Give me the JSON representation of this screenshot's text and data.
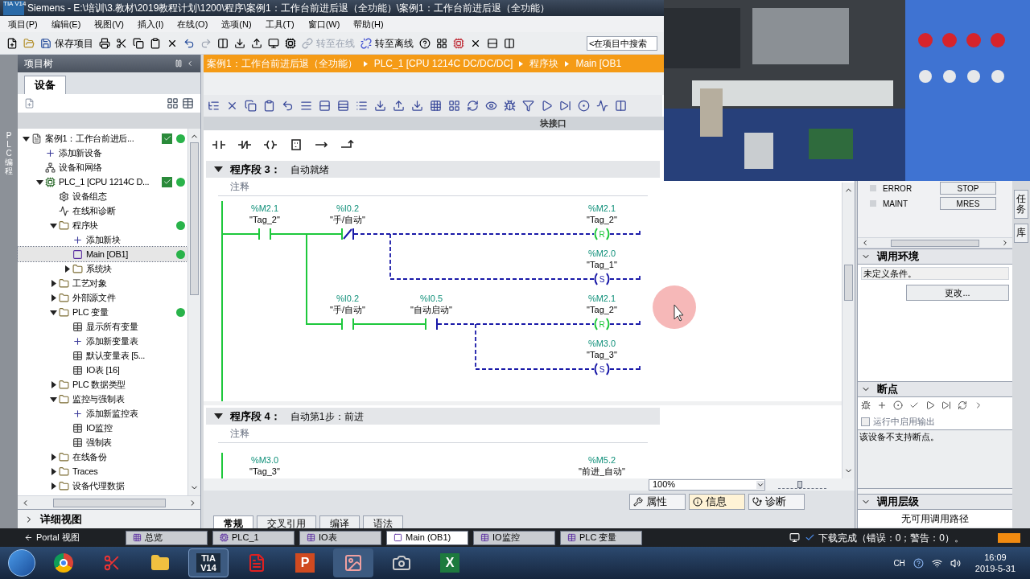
{
  "window": {
    "app_icon": "TIA V14",
    "title": "Siemens  -  E:\\培训\\3.教材\\2019教程计划\\1200\\程序\\案例1：工作台前进后退（全功能）\\案例1：工作台前进后退（全功能）"
  },
  "menu": [
    "项目(P)",
    "编辑(E)",
    "视图(V)",
    "插入(I)",
    "在线(O)",
    "选项(N)",
    "工具(T)",
    "窗口(W)",
    "帮助(H)"
  ],
  "toolbar": {
    "save": "保存项目",
    "go_online": {
      "label": "转至在线",
      "disabled": true
    },
    "go_offline": {
      "label": "转至离线",
      "disabled": false
    },
    "search": {
      "placeholder": "<在项目中搜索"
    }
  },
  "portal_strip": "PLC 编程",
  "project_tree": {
    "title": "项目树",
    "tab": "设备",
    "items": [
      {
        "label": "案例1：工作台前进后...",
        "kind": "project",
        "expanded": true,
        "selected": false,
        "consistent": true,
        "online": true,
        "children": [
          {
            "label": "添加新设备",
            "kind": "add",
            "selected": false
          },
          {
            "label": "设备和网络",
            "kind": "network",
            "selected": false
          },
          {
            "label": "PLC_1 [CPU 1214C D...",
            "kind": "plc",
            "expanded": true,
            "selected": false,
            "consistent": true,
            "online": true,
            "children": [
              {
                "label": "设备组态",
                "kind": "config",
                "selected": false
              },
              {
                "label": "在线和诊断",
                "kind": "diag",
                "selected": false
              },
              {
                "label": "程序块",
                "kind": "folder",
                "expanded": true,
                "selected": false,
                "online": true,
                "children": [
                  {
                    "label": "添加新块",
                    "kind": "add",
                    "selected": false
                  },
                  {
                    "label": "Main [OB1]",
                    "kind": "block",
                    "selected": true,
                    "online": true
                  },
                  {
                    "label": "系统块",
                    "kind": "folder",
                    "expanded": false,
                    "selected": false
                  }
                ]
              },
              {
                "label": "工艺对象",
                "kind": "folder",
                "expanded": false,
                "selected": false
              },
              {
                "label": "外部源文件",
                "kind": "folder",
                "expanded": false,
                "selected": false
              },
              {
                "label": "PLC 变量",
                "kind": "folder",
                "expanded": true,
                "selected": false,
                "online": true,
                "children": [
                  {
                    "label": "显示所有变量",
                    "kind": "table",
                    "selected": false
                  },
                  {
                    "label": "添加新变量表",
                    "kind": "add",
                    "selected": false
                  },
                  {
                    "label": "默认变量表 [5...",
                    "kind": "table",
                    "selected": false
                  },
                  {
                    "label": "IO表 [16]",
                    "kind": "table",
                    "selected": false
                  }
                ]
              },
              {
                "label": "PLC 数据类型",
                "kind": "folder",
                "expanded": false,
                "selected": false
              },
              {
                "label": "监控与强制表",
                "kind": "folder",
                "expanded": true,
                "selected": false,
                "children": [
                  {
                    "label": "添加新监控表",
                    "kind": "add",
                    "selected": false
                  },
                  {
                    "label": "IO监控",
                    "kind": "table",
                    "selected": false
                  },
                  {
                    "label": "强制表",
                    "kind": "table",
                    "selected": false
                  }
                ]
              },
              {
                "label": "在线备份",
                "kind": "folder",
                "expanded": false,
                "selected": false
              },
              {
                "label": "Traces",
                "kind": "folder",
                "expanded": false,
                "selected": false
              },
              {
                "label": "设备代理数据",
                "kind": "folder",
                "expanded": false,
                "selected": false
              }
            ]
          }
        ]
      }
    ]
  },
  "detail_view": {
    "label": "详细视图",
    "expanded": false
  },
  "editor": {
    "breadcrumb": [
      "案例1：工作台前进后退（全功能）",
      "PLC_1 [CPU 1214C DC/DC/DC]",
      "程序块",
      "Main [OB1"
    ],
    "interface_label": "块接口",
    "zoom": "100%",
    "zoom_slider": {
      "level": 0.45
    },
    "networks": [
      {
        "number": "程序段 3：",
        "title": "自动就绪",
        "comment": "注释",
        "expanded": true,
        "power_flow": true,
        "elements": [
          {
            "kind": "no_contact",
            "address": "%M2.1",
            "tag": "\"Tag_2\"",
            "powered": true
          },
          {
            "kind": "nc_contact",
            "address": "%I0.2",
            "tag": "\"手/自动\"",
            "powered": false
          },
          {
            "kind": "coil",
            "letter": "R",
            "address": "%M2.1",
            "tag": "\"Tag_2\"",
            "energized": true
          },
          {
            "kind": "coil",
            "letter": "S",
            "address": "%M2.0",
            "tag": "\"Tag_1\"",
            "energized": false
          },
          {
            "kind": "no_contact",
            "address": "%I0.2",
            "tag": "\"手/自动\"",
            "powered": true
          },
          {
            "kind": "no_contact",
            "address": "%I0.5",
            "tag": "\"自动启动\"",
            "powered": false
          },
          {
            "kind": "coil",
            "letter": "R",
            "address": "%M2.1",
            "tag": "\"Tag_2\"",
            "energized": true
          },
          {
            "kind": "coil",
            "letter": "S",
            "address": "%M3.0",
            "tag": "\"Tag_3\"",
            "energized": false
          }
        ]
      },
      {
        "number": "程序段 4：",
        "title": "自动第1步：前进",
        "comment": "注释",
        "expanded": true,
        "power_flow": true,
        "elements": [
          {
            "address": "%M3.0",
            "tag": "\"Tag_3\""
          },
          {
            "address": "%M5.2",
            "tag": "\"前进_自动\""
          }
        ]
      }
    ]
  },
  "inspector": {
    "tabs": [
      {
        "label": "属性",
        "selected": false
      },
      {
        "label": "信息",
        "selected": true
      },
      {
        "label": "诊断",
        "selected": false
      }
    ],
    "subtabs": [
      {
        "label": "常规",
        "selected": true
      },
      {
        "label": "交叉引用",
        "selected": false
      },
      {
        "label": "编译",
        "selected": false
      },
      {
        "label": "语法",
        "selected": false
      }
    ]
  },
  "right_panel": {
    "cpu_rows": [
      {
        "led": "ERROR",
        "button": "STOP"
      },
      {
        "led": "MAINT",
        "button": "MRES"
      }
    ],
    "call_env": {
      "title": "调用环境",
      "expanded": true,
      "condition": "未定义条件。",
      "button": "更改..."
    },
    "breakpoints": {
      "title": "断点",
      "expanded": true,
      "option": {
        "label": "运行中启用输出",
        "checked": false
      },
      "message": "该设备不支持断点。"
    },
    "call_hierarchy": {
      "title": "调用层级",
      "expanded": true,
      "message": "无可用调用路径"
    }
  },
  "side_tabs": [
    "任务",
    "库"
  ],
  "portal_bar": {
    "portal_view": "Portal 视图",
    "tabs": [
      {
        "label": "总览",
        "kind": "overview",
        "selected": false
      },
      {
        "label": "PLC_1",
        "kind": "device",
        "selected": false
      },
      {
        "label": "IO表",
        "kind": "table",
        "selected": false
      },
      {
        "label": "Main (OB1)",
        "kind": "block",
        "selected": true
      },
      {
        "label": "IO监控",
        "kind": "table",
        "selected": false
      },
      {
        "label": "PLC 变量",
        "kind": "table",
        "selected": false
      }
    ],
    "status": "下载完成（错误：0；警告：0）。"
  },
  "taskbar": {
    "apps": [
      {
        "kind": "chrome"
      },
      {
        "kind": "snip"
      },
      {
        "kind": "explorer"
      },
      {
        "kind": "tia",
        "label": "TIA V14"
      },
      {
        "kind": "pdf"
      },
      {
        "kind": "ppt",
        "label": "P"
      },
      {
        "kind": "paint"
      },
      {
        "kind": "camera"
      },
      {
        "kind": "excel",
        "label": "X"
      }
    ],
    "language": "CH",
    "time": "16:09",
    "date": "2019-5-31"
  }
}
